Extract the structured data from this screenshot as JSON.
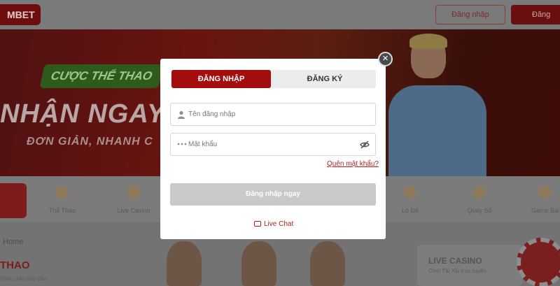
{
  "site": {
    "logo": "MBET",
    "header": {
      "login_label": "Đăng nhập",
      "register_label": "Đăng ký"
    },
    "banner": {
      "promo_pill": "CƯỢC THỂ THAO",
      "headline": "NHẬN NGAY",
      "subline": "ĐƠN GIẢN, NHANH C"
    },
    "categories": [
      "Thể Thao",
      "Live Casino",
      "Lô Đề",
      "Quay Số",
      "Game Bài"
    ],
    "breadcrumb": "Home",
    "section": {
      "title": "THAO",
      "subtitle": "Nhiều kèo hấp dẫn"
    },
    "casino": {
      "title": "LIVE CASINO",
      "subtitle": "Chơi Tài Xỉu trực tuyến"
    }
  },
  "modal": {
    "close_icon": "close-icon",
    "tabs": [
      {
        "label": "ĐĂNG NHẬP",
        "active": true
      },
      {
        "label": "ĐĂNG KÝ",
        "active": false
      }
    ],
    "username": {
      "placeholder": "Tên đăng nhập",
      "value": ""
    },
    "password": {
      "placeholder": "Mật khẩu",
      "value": ""
    },
    "forgot_label": "Quên mật khẩu?",
    "submit_label": "Đăng nhập ngay",
    "livechat_label": "Live Chat",
    "accent_color": "#a30d0d",
    "link_color": "#b51f1f"
  }
}
